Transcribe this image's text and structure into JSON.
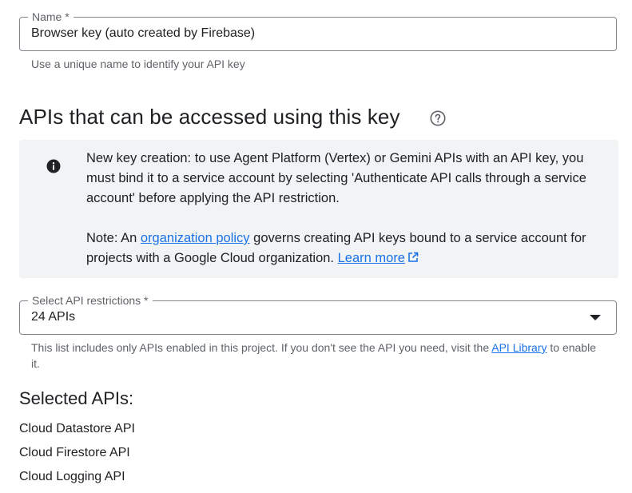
{
  "name_field": {
    "label": "Name *",
    "value": "Browser key (auto created by Firebase)",
    "hint": "Use a unique name to identify your API key"
  },
  "apis_section": {
    "title": "APIs that can be accessed using this key",
    "help_icon": "help-circle-icon"
  },
  "info_box": {
    "icon": "info-icon",
    "paragraph1": "New key creation: to use Agent Platform (Vertex) or Gemini APIs with an API key, you must bind it to a service account by selecting 'Authenticate API calls through a service account' before applying the API restriction.",
    "note_prefix": "Note: An ",
    "org_policy_link": "organization policy",
    "note_middle": " governs creating API keys bound to a service account for projects with a Google Cloud organization. ",
    "learn_more_link": "Learn more",
    "learn_more_icon": "open-in-new-icon"
  },
  "api_restrictions": {
    "label": "Select API restrictions *",
    "value": "24 APIs",
    "hint_prefix": "This list includes only APIs enabled in this project. If you don't see the API you need, visit the ",
    "hint_link": "API Library",
    "hint_suffix": " to enable it."
  },
  "selected_apis": {
    "title": "Selected APIs:",
    "items": [
      "Cloud Datastore API",
      "Cloud Firestore API",
      "Cloud Logging API"
    ]
  },
  "colors": {
    "link": "#1a73e8",
    "info_background": "#f1f3f4",
    "border": "#80868b"
  }
}
